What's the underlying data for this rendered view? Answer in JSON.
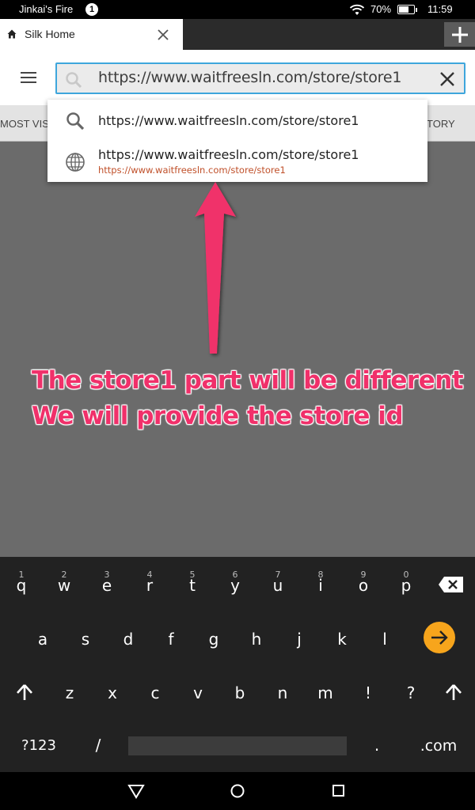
{
  "status_bar": {
    "owner": "Jinkai's Fire",
    "notification_count": "1",
    "battery_percent": "70%",
    "battery_level": 0.7,
    "time": "11:59"
  },
  "tab": {
    "title": "Silk Home",
    "icon": "home-icon"
  },
  "toolbar": {
    "url_value": "https://www.waitfreesln.com/store/store1"
  },
  "navstrip": {
    "left_label": "MOST VISI",
    "right_label": "TORY"
  },
  "suggestions": [
    {
      "icon": "search-icon",
      "main": "https://www.waitfreesln.com/store/store1",
      "sub": ""
    },
    {
      "icon": "globe-icon",
      "main": "https://www.waitfreesln.com/store/store1",
      "sub": "https://www.waitfreesln.com/store/store1"
    }
  ],
  "annotation": {
    "line1": "The store1 part will be different",
    "line2": "We will provide the store id",
    "color": "#f0306a"
  },
  "keyboard": {
    "row1": [
      {
        "key": "q",
        "num": "1"
      },
      {
        "key": "w",
        "num": "2"
      },
      {
        "key": "e",
        "num": "3"
      },
      {
        "key": "r",
        "num": "4"
      },
      {
        "key": "t",
        "num": "5"
      },
      {
        "key": "y",
        "num": "6"
      },
      {
        "key": "u",
        "num": "7"
      },
      {
        "key": "i",
        "num": "8"
      },
      {
        "key": "o",
        "num": "9"
      },
      {
        "key": "p",
        "num": "0"
      }
    ],
    "row2": [
      "a",
      "s",
      "d",
      "f",
      "g",
      "h",
      "j",
      "k",
      "l"
    ],
    "row3": [
      "z",
      "x",
      "c",
      "v",
      "b",
      "n",
      "m",
      "!",
      "?"
    ],
    "symbols_label": "?123",
    "slash": "/",
    "dot": ".",
    "dotcom": ".com",
    "go_color": "#f7a51c"
  }
}
